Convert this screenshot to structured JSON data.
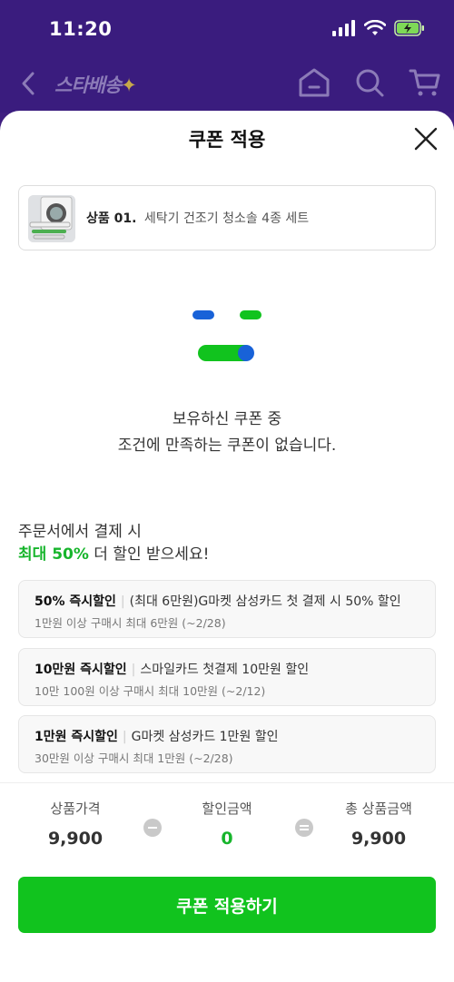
{
  "status_bar": {
    "time": "11:20"
  },
  "app_bar": {
    "logo": "스타배송",
    "logo_star": "✦"
  },
  "sheet": {
    "title": "쿠폰 적용",
    "product": {
      "number": "상품 01.",
      "name": "세탁기 건조기 청소솔 4종 세트"
    },
    "empty_message": {
      "line1": "보유하신 쿠폰 중",
      "line2": "조건에 만족하는 쿠폰이 없습니다."
    },
    "promo": {
      "line1": "주문서에서 결제 시",
      "highlight": "최대 50%",
      "line2_rest": " 더 할인 받으세요!"
    },
    "coupons": [
      {
        "title": "50% 즉시할인",
        "desc": "(최대 6만원)G마켓 삼성카드 첫 결제 시 50% 할인",
        "condition": "1만원 이상 구매시 최대 6만원 (~2/28)"
      },
      {
        "title": "10만원 즉시할인",
        "desc": "스마일카드 첫결제 10만원 할인",
        "condition": "10만 100원 이상 구매시 최대 10만원 (~2/12)"
      },
      {
        "title": "1만원 즉시할인",
        "desc": "G마켓 삼성카드 1만원 할인",
        "condition": "30만원 이상 구매시 최대 1만원 (~2/28)"
      }
    ],
    "summary": {
      "price_label": "상품가격",
      "price_value": "9,900",
      "discount_label": "할인금액",
      "discount_value": "0",
      "total_label": "총 상품금액",
      "total_value": "9,900"
    },
    "apply_button": "쿠폰 적용하기"
  },
  "colors": {
    "accent_green": "#11c31e",
    "header_purple": "#3a1c7e",
    "face_blue": "#1862d8"
  },
  "icons": [
    "signal-icon",
    "wifi-icon",
    "battery-icon",
    "back-icon",
    "home-icon",
    "search-icon",
    "cart-icon",
    "close-icon"
  ]
}
